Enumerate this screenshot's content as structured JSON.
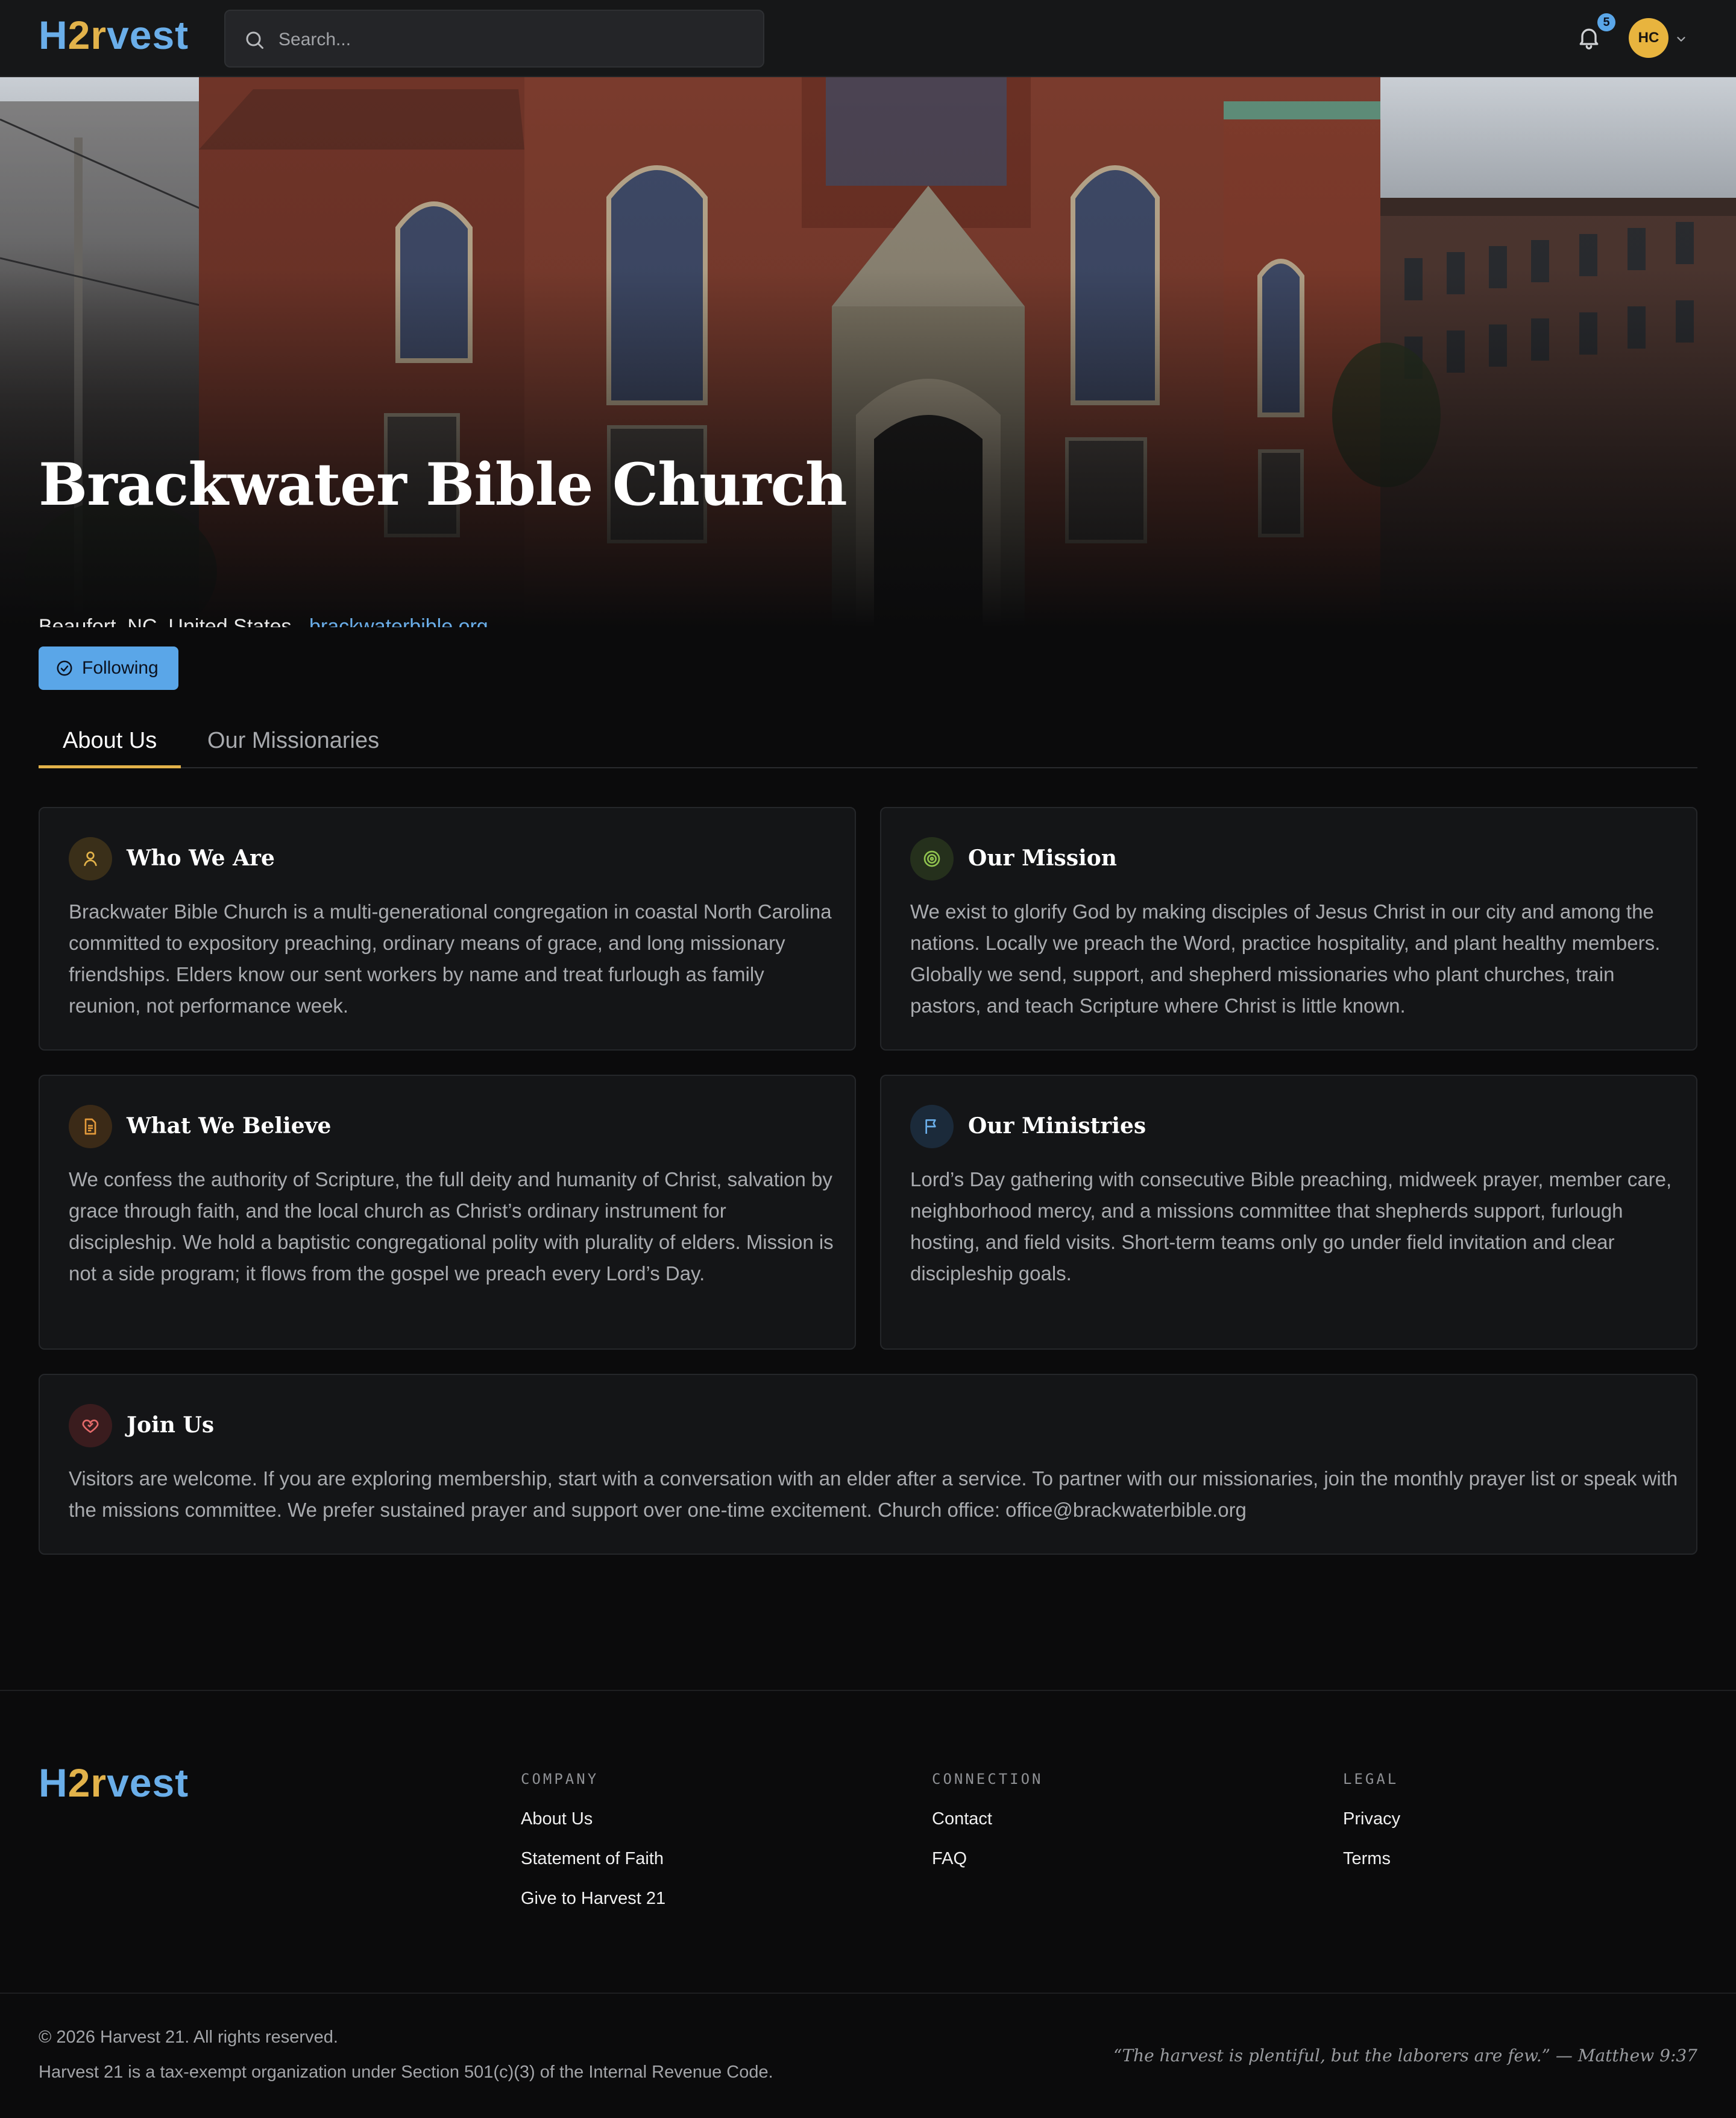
{
  "brand": {
    "logo_prefix": "H",
    "logo_accent": "2r",
    "logo_suffix": "vest",
    "primary_color": "#6aaee9",
    "accent_color": "#e2b24a"
  },
  "header": {
    "search_placeholder": "Search...",
    "notification_count": "5",
    "avatar_initials": "HC"
  },
  "church": {
    "name": "Brackwater Bible Church",
    "location": "Beaufort, NC, United States",
    "website": "brackwaterbible.org"
  },
  "follow_button": {
    "label": "Following"
  },
  "tabs": [
    {
      "label": "About Us",
      "active": true
    },
    {
      "label": "Our Missionaries",
      "active": false
    }
  ],
  "sections": [
    {
      "title": "Who We Are",
      "icon": "person-icon",
      "body": "Brackwater Bible Church is a multi-generational congregation in coastal North Carolina committed to expository preaching, ordinary means of grace, and long missionary friendships. Elders know our sent workers by name and treat furlough as family reunion, not performance week."
    },
    {
      "title": "Our Mission",
      "icon": "target-icon",
      "body": "We exist to glorify God by making disciples of Jesus Christ in our city and among the nations. Locally we preach the Word, practice hospitality, and plant healthy members. Globally we send, support, and shepherd missionaries who plant churches, train pastors, and teach Scripture where Christ is little known."
    },
    {
      "title": "What We Believe",
      "icon": "document-icon",
      "body": "We confess the authority of Scripture, the full deity and humanity of Christ, salvation by grace through faith, and the local church as Christ’s ordinary instrument for discipleship. We hold a baptistic congregational polity with plurality of elders. Mission is not a side program; it flows from the gospel we preach every Lord’s Day."
    },
    {
      "title": "Our Ministries",
      "icon": "flag-icon",
      "body": "Lord’s Day gathering with consecutive Bible preaching, midweek prayer, member care, neighborhood mercy, and a missions committee that shepherds support, furlough hosting, and field visits. Short-term teams only go under field invitation and clear discipleship goals."
    },
    {
      "title": "Join Us",
      "icon": "heart-handshake-icon",
      "body": "Visitors are welcome. If you are exploring membership, start with a conversation with an elder after a service. To partner with our missionaries, join the monthly prayer list or speak with the missions committee. We prefer sustained prayer and support over one-time excitement. Church office: office@brackwaterbible.org"
    }
  ],
  "footer": {
    "columns": [
      {
        "heading": "COMPANY",
        "links": [
          "About Us",
          "Statement of Faith",
          "Give to Harvest 21"
        ]
      },
      {
        "heading": "CONNECTION",
        "links": [
          "Contact",
          "FAQ"
        ]
      },
      {
        "heading": "LEGAL",
        "links": [
          "Privacy",
          "Terms"
        ]
      }
    ],
    "copyright": "© 2026 Harvest 21. All rights reserved.",
    "tax_note": "Harvest 21 is a tax-exempt organization under Section 501(c)(3) of the Internal Revenue Code.",
    "verse": "“The harvest is plentiful, but the laborers are few.” — Matthew 9:37"
  }
}
